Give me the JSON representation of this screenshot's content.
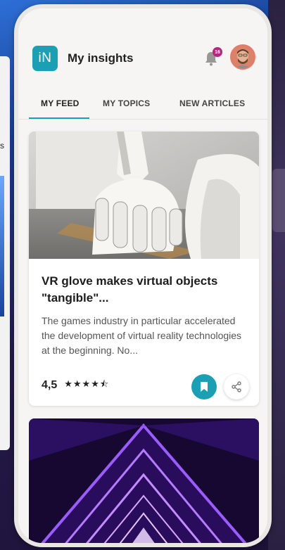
{
  "app": {
    "logo_text": "iN",
    "title": "My insights",
    "notification_count": "16"
  },
  "tabs": [
    {
      "label": "MY FEED",
      "active": true
    },
    {
      "label": "MY TOPICS",
      "active": false
    },
    {
      "label": "NEW ARTICLES",
      "active": false
    }
  ],
  "articles": [
    {
      "image_icon": "robot-hand-image",
      "title": "VR glove makes virtual objects \"tangible\"...",
      "excerpt": "The games industry in particular accelerated the development of virtual reality technologies at the beginning. No...",
      "rating": "4,5",
      "stars_value": 4.5,
      "stars_max": 5
    },
    {
      "image_icon": "purple-neon-tunnel-image"
    }
  ],
  "background": {
    "partial_text": "s"
  },
  "colors": {
    "accent": "#1a9fb3",
    "badge": "#b0287f",
    "tunnel": "#8a3bff"
  }
}
